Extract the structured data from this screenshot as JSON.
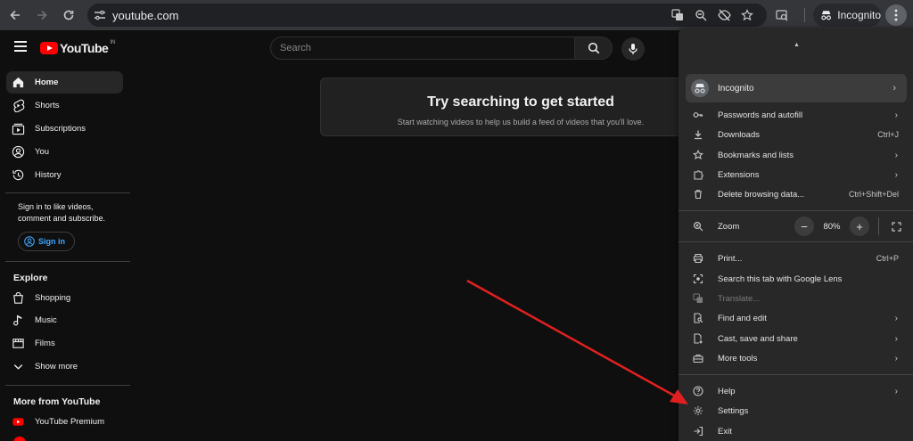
{
  "browser": {
    "url": "youtube.com",
    "incognito_label": "Incognito"
  },
  "youtube": {
    "logo_text": "YouTube",
    "logo_region": "IN",
    "search_placeholder": "Search",
    "sidebar": {
      "items": [
        {
          "label": "Home",
          "icon": "home-icon"
        },
        {
          "label": "Shorts",
          "icon": "shorts-icon"
        },
        {
          "label": "Subscriptions",
          "icon": "subscriptions-icon"
        },
        {
          "label": "You",
          "icon": "you-icon"
        },
        {
          "label": "History",
          "icon": "history-icon"
        }
      ],
      "signin_text": "Sign in to like videos, comment and subscribe.",
      "signin_button": "Sign in",
      "explore_heading": "Explore",
      "explore_items": [
        {
          "label": "Shopping",
          "icon": "shopping-icon"
        },
        {
          "label": "Music",
          "icon": "music-icon"
        },
        {
          "label": "Films",
          "icon": "films-icon"
        },
        {
          "label": "Show more",
          "icon": "chevron-down-icon"
        }
      ],
      "more_heading": "More from YouTube",
      "more_items": [
        {
          "label": "YouTube Premium",
          "icon": "youtube-premium-icon"
        }
      ]
    },
    "prompt": {
      "title": "Try searching to get started",
      "subtitle": "Start watching videos to help us build a feed of videos that you'll love."
    }
  },
  "chrome_menu": {
    "profile_label": "Incognito",
    "group1": [
      {
        "label": "Passwords and autofill",
        "shortcut": "",
        "submenu": true
      },
      {
        "label": "Downloads",
        "shortcut": "Ctrl+J",
        "submenu": false
      },
      {
        "label": "Bookmarks and lists",
        "shortcut": "",
        "submenu": true
      },
      {
        "label": "Extensions",
        "shortcut": "",
        "submenu": true
      },
      {
        "label": "Delete browsing data...",
        "shortcut": "Ctrl+Shift+Del",
        "submenu": false
      }
    ],
    "zoom": {
      "label": "Zoom",
      "value": "80%",
      "minus": "−",
      "plus": "+"
    },
    "group2": [
      {
        "label": "Print...",
        "shortcut": "Ctrl+P",
        "submenu": false,
        "disabled": false
      },
      {
        "label": "Search this tab with Google Lens",
        "shortcut": "",
        "submenu": false,
        "disabled": false
      },
      {
        "label": "Translate...",
        "shortcut": "",
        "submenu": false,
        "disabled": true
      },
      {
        "label": "Find and edit",
        "shortcut": "",
        "submenu": true,
        "disabled": false
      },
      {
        "label": "Cast, save and share",
        "shortcut": "",
        "submenu": true,
        "disabled": false
      },
      {
        "label": "More tools",
        "shortcut": "",
        "submenu": true,
        "disabled": false
      }
    ],
    "group3": [
      {
        "label": "Help",
        "shortcut": "",
        "submenu": true
      },
      {
        "label": "Settings",
        "shortcut": "",
        "submenu": false
      },
      {
        "label": "Exit",
        "shortcut": "",
        "submenu": false
      }
    ]
  },
  "colors": {
    "yt_red": "#ff0000",
    "link_blue": "#3ea6ff",
    "arrow_red": "#e02020"
  }
}
